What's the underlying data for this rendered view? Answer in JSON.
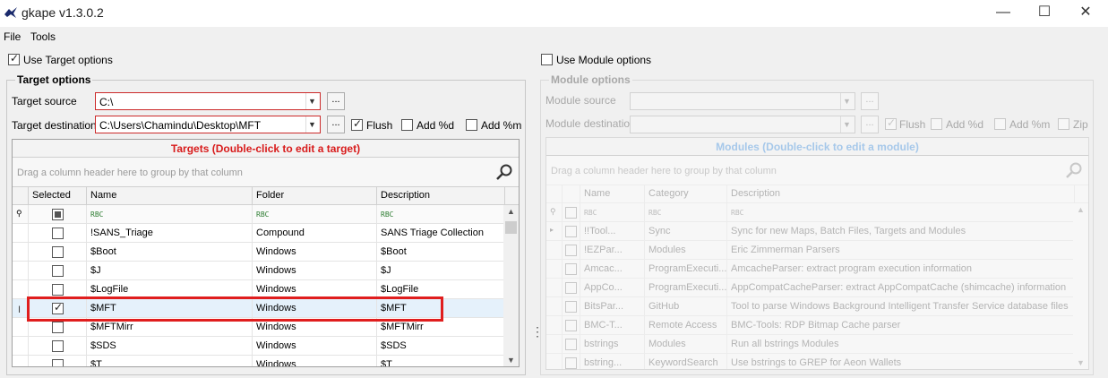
{
  "window": {
    "title": "gkape v1.3.0.2",
    "minimize_glyph": "—",
    "maximize_glyph": "☐",
    "close_glyph": "✕"
  },
  "menu": [
    "File",
    "Tools"
  ],
  "target": {
    "use_label": "Use Target options",
    "use_checked": true,
    "group_title": "Target options",
    "source_label": "Target source",
    "source_value": "C:\\",
    "dest_label": "Target destination",
    "dest_value": "C:\\Users\\Chamindu\\Desktop\\MFT",
    "browse_label": "...",
    "flush_label": "Flush",
    "flush_checked": true,
    "add_d_label": "Add %d",
    "add_m_label": "Add %m",
    "grid_caption": "Targets (Double-click to edit a target)",
    "group_hint": "Drag a column header here to group by that column",
    "columns": [
      "Selected",
      "Name",
      "Folder",
      "Description"
    ],
    "filter_glyph": "RBC",
    "rows": [
      {
        "checked": false,
        "name": "!SANS_Triage",
        "folder": "Compound",
        "desc": "SANS Triage Collection"
      },
      {
        "checked": false,
        "name": "$Boot",
        "folder": "Windows",
        "desc": "$Boot"
      },
      {
        "checked": false,
        "name": "$J",
        "folder": "Windows",
        "desc": "$J"
      },
      {
        "checked": false,
        "name": "$LogFile",
        "folder": "Windows",
        "desc": "$LogFile"
      },
      {
        "checked": true,
        "name": "$MFT",
        "folder": "Windows",
        "desc": "$MFT"
      },
      {
        "checked": false,
        "name": "$MFTMirr",
        "folder": "Windows",
        "desc": "$MFTMirr"
      },
      {
        "checked": false,
        "name": "$SDS",
        "folder": "Windows",
        "desc": "$SDS"
      },
      {
        "checked": false,
        "name": "$T",
        "folder": "Windows",
        "desc": "$T"
      }
    ]
  },
  "module": {
    "use_label": "Use Module options",
    "use_checked": false,
    "group_title": "Module options",
    "source_label": "Module source",
    "dest_label": "Module destination",
    "browse_label": "...",
    "flush_label": "Flush",
    "add_d_label": "Add %d",
    "add_m_label": "Add %m",
    "zip_label": "Zip",
    "grid_caption": "Modules (Double-click to edit a module)",
    "group_hint": "Drag a column header here to group by that column",
    "columns": [
      "Name",
      "Category",
      "Description"
    ],
    "filter_glyph": "RBC",
    "rows": [
      {
        "name": "!!Tool...",
        "category": "Sync",
        "desc": "Sync for new Maps, Batch Files, Targets and Modules"
      },
      {
        "name": "!EZPar...",
        "category": "Modules",
        "desc": "Eric Zimmerman Parsers"
      },
      {
        "name": "Amcac...",
        "category": "ProgramExecuti...",
        "desc": "AmcacheParser: extract program execution information"
      },
      {
        "name": "AppCo...",
        "category": "ProgramExecuti...",
        "desc": "AppCompatCacheParser: extract AppCompatCache (shimcache) information"
      },
      {
        "name": "BitsPar...",
        "category": "GitHub",
        "desc": "Tool to parse Windows Background Intelligent Transfer Service database files"
      },
      {
        "name": "BMC-T...",
        "category": "Remote Access",
        "desc": "BMC-Tools: RDP Bitmap Cache parser"
      },
      {
        "name": "bstrings",
        "category": "Modules",
        "desc": "Run all bstrings Modules"
      },
      {
        "name": "bstring...",
        "category": "KeywordSearch",
        "desc": "Use bstrings to GREP for Aeon Wallets"
      }
    ]
  },
  "splitter_glyph": "⋮"
}
